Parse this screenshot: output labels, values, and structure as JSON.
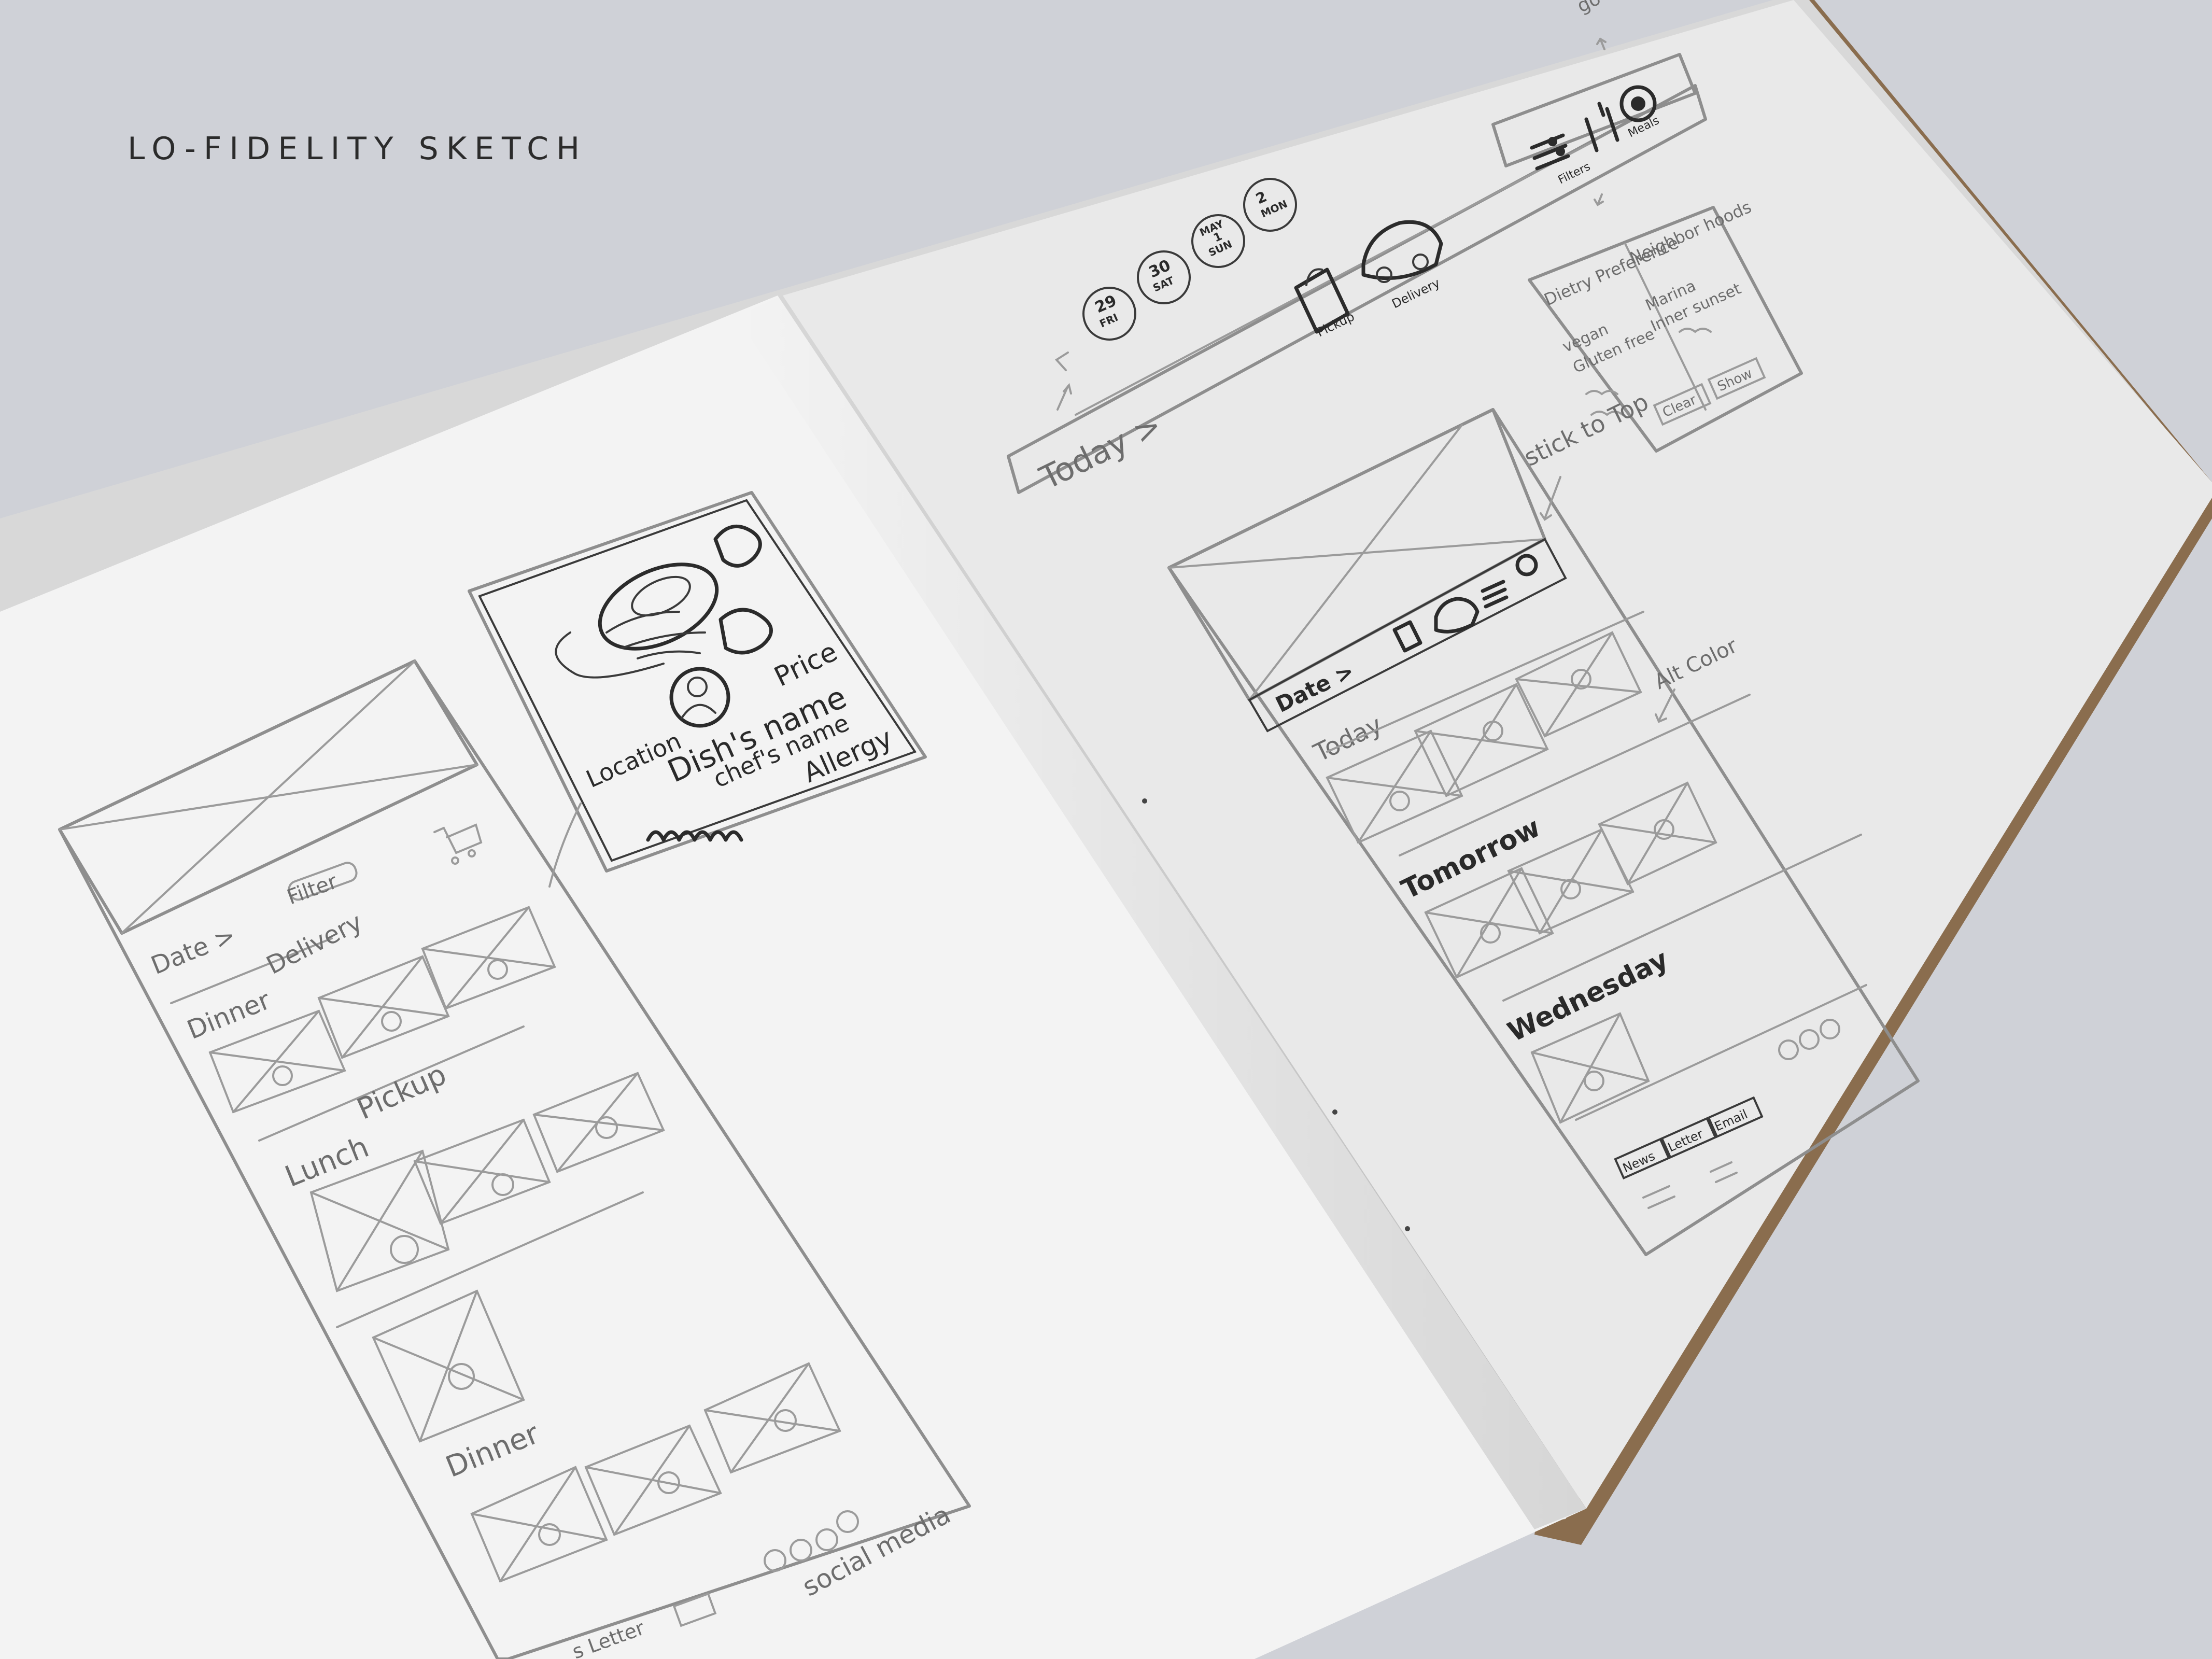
{
  "heading": "LO-FIDELITY SKETCH",
  "colors": {
    "background": "#cfd1d7",
    "paper_left": "#f3f3f3",
    "paper_right": "#e9e9e9",
    "cover": "#8a6d4e",
    "pencil": "#8e8e8e",
    "ink": "#2b2b2b"
  },
  "left_page": {
    "header_labels": {
      "filter": "Filter",
      "date": "Date >",
      "delivery": "Delivery"
    },
    "sections": [
      {
        "label": "Dinner"
      },
      {
        "label": "Pickup"
      },
      {
        "label": "Lunch"
      },
      {
        "label": "Dinner"
      }
    ],
    "footer": {
      "newsletter": "s Letter",
      "social": "social media"
    },
    "cart_icon": "cart-icon"
  },
  "detail_card": {
    "price": "Price",
    "location": "Location",
    "dish_name": "Dish's name",
    "chef_name": "chef's name",
    "allergy": "Allergy",
    "avatar_icon": "chef-avatar-icon"
  },
  "right_page": {
    "top_note": "go to check out page",
    "nav": {
      "today": "Today >",
      "dates": [
        {
          "day": "29",
          "dow": "FRI"
        },
        {
          "day": "30",
          "dow": "SAT"
        },
        {
          "day": "1",
          "dow": "SUN",
          "month": "MAY"
        },
        {
          "day": "2",
          "dow": "MON"
        }
      ],
      "pickup": "Pickup",
      "delivery": "Delivery",
      "filters": "Filters",
      "meals": "Meals"
    },
    "filter_panel": {
      "col1_title": "Dietry Preference",
      "col1_items": [
        "vegan",
        "Gluten free"
      ],
      "col2_title": "Neighbor hoods",
      "col2_items": [
        "Marina",
        "Inner sunset"
      ],
      "clear": "Clear",
      "show": "Show"
    },
    "phone": {
      "note_sticky": "stick to Top",
      "note_color": "Alt Color",
      "date_bar": "Date >",
      "sections": [
        {
          "label": "Today"
        },
        {
          "label": "Tomorrow"
        },
        {
          "label": "Wednesday"
        }
      ],
      "tabs": [
        "News",
        "Letter",
        "Email"
      ]
    }
  }
}
